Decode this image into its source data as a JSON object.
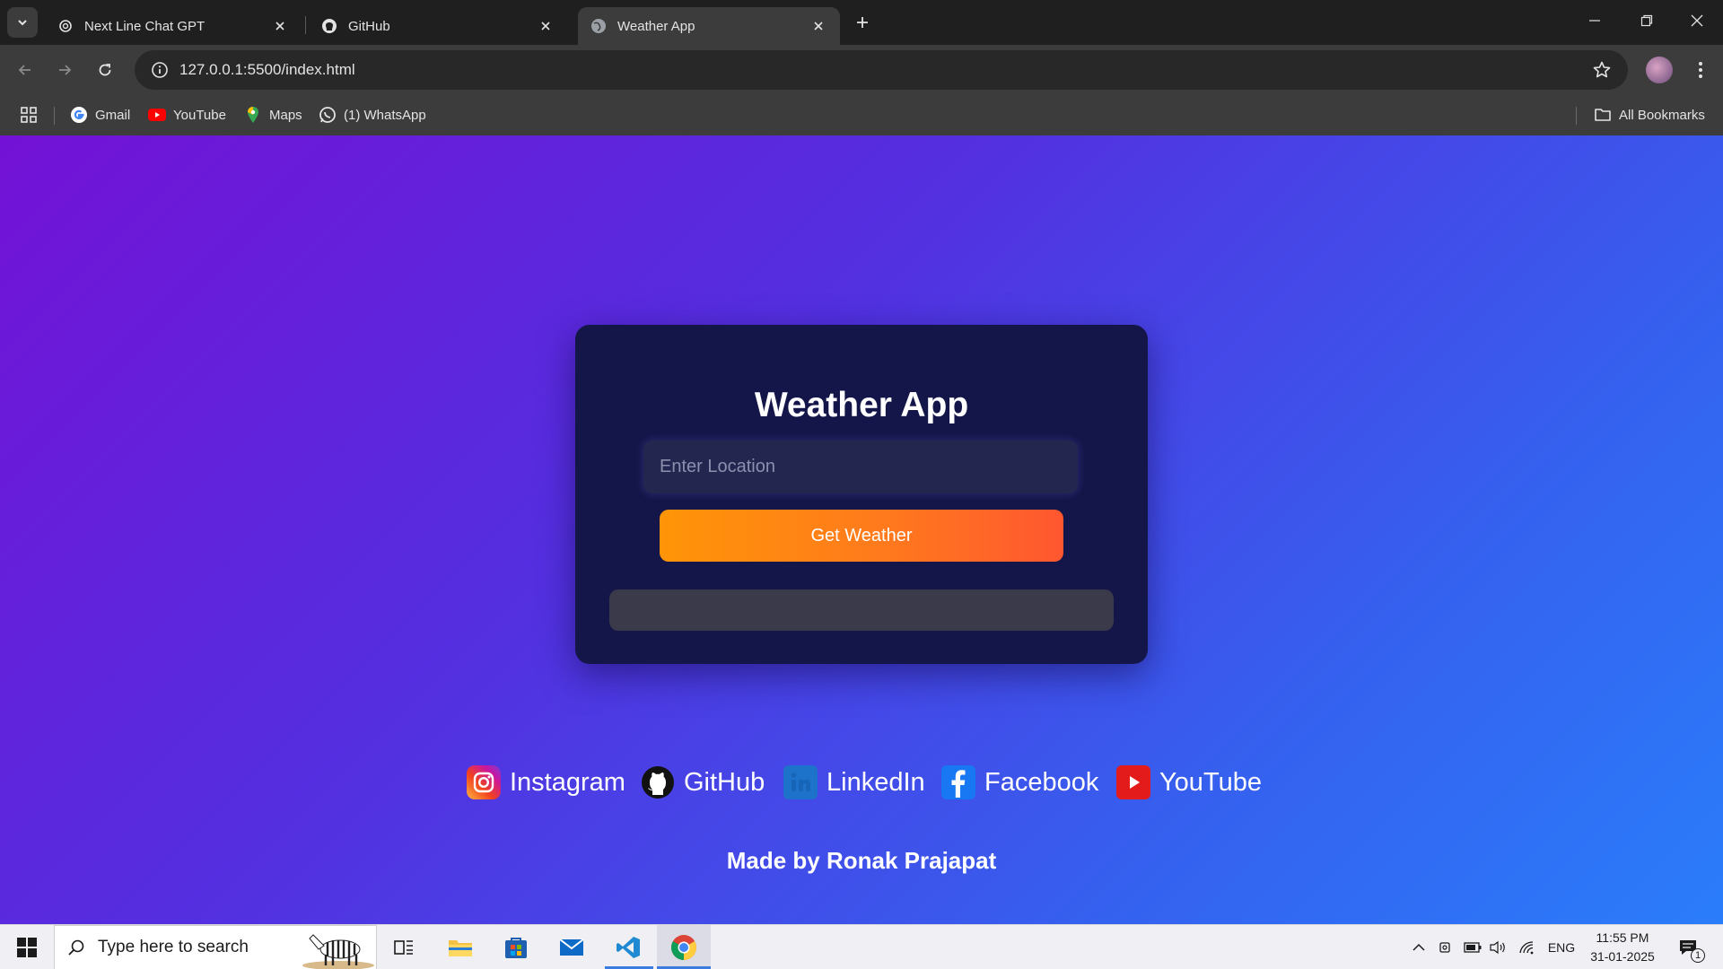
{
  "browser": {
    "tabs": [
      {
        "title": "Next Line Chat GPT",
        "icon": "chatgpt-icon",
        "active": false
      },
      {
        "title": "GitHub",
        "icon": "github-icon",
        "active": false
      },
      {
        "title": "Weather App",
        "icon": "globe-icon",
        "active": true
      }
    ],
    "url": "127.0.0.1:5500/index.html",
    "bookmarks": [
      {
        "label": "Gmail",
        "icon": "google-icon"
      },
      {
        "label": "YouTube",
        "icon": "youtube-icon"
      },
      {
        "label": "Maps",
        "icon": "maps-icon"
      },
      {
        "label": "(1) WhatsApp",
        "icon": "whatsapp-icon"
      }
    ],
    "all_bookmarks": "All Bookmarks"
  },
  "app": {
    "title": "Weather App",
    "location_placeholder": "Enter Location",
    "button_label": "Get Weather",
    "result_text": "",
    "socials": [
      {
        "label": "Instagram",
        "icon": "instagram-icon"
      },
      {
        "label": "GitHub",
        "icon": "github-icon"
      },
      {
        "label": "LinkedIn",
        "icon": "linkedin-icon"
      },
      {
        "label": "Facebook",
        "icon": "facebook-icon"
      },
      {
        "label": "YouTube",
        "icon": "youtube-icon"
      }
    ],
    "credit": "Made by Ronak Prajapat"
  },
  "colors": {
    "gradient_start": "#7312d6",
    "gradient_end": "#2a7dfb",
    "card_bg": "#141649",
    "button_start": "#ff9507",
    "button_end": "#ff5730"
  },
  "taskbar": {
    "search_placeholder": "Type here to search",
    "language": "ENG",
    "time": "11:55 PM",
    "date": "31-01-2025",
    "notification_count": "1"
  }
}
